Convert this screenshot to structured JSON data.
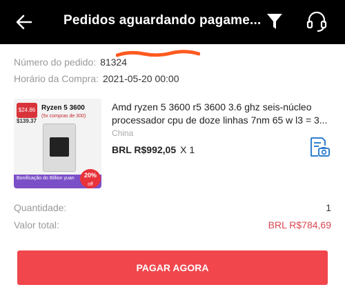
{
  "header": {
    "title": "Pedidos aguardando pagame...",
    "back_icon": "arrow-left-icon",
    "filter_icon": "filter-icon",
    "support_icon": "headset-icon"
  },
  "order": {
    "number_label": "Número do pedido:",
    "number_value": "81324",
    "time_label": "Horário da Compra:",
    "time_value": "2021-05-20 00:00"
  },
  "product": {
    "title_line1": "Amd ryzen 5 3600 r5 3600 3.6 ghz seis-núcleo",
    "title_line2": "processador cpu de doze linhas 7nm 65 w l3 = 3...",
    "origin": "China",
    "price": "BRL R$992,05",
    "quantity": "X 1",
    "snapshot_icon": "document-camera-icon",
    "thumbnail": {
      "name": "Ryzen 5 3600",
      "sub": "(5x compras de 300)",
      "tag": "$24.86",
      "price": "$139.37",
      "banner": "Bonificação do Billion yuan",
      "discount": "20%",
      "discount_off": "off"
    }
  },
  "summary": {
    "quantity_label": "Quantidade:",
    "quantity_value": "1",
    "total_label": "Valor total:",
    "total_value": "BRL R$784,69"
  },
  "actions": {
    "pay_label": "PAGAR AGORA"
  },
  "colors": {
    "header_bg": "#000000",
    "accent": "#f0464c",
    "total_value": "#d9464e",
    "snapshot_icon": "#2f7fcf"
  }
}
